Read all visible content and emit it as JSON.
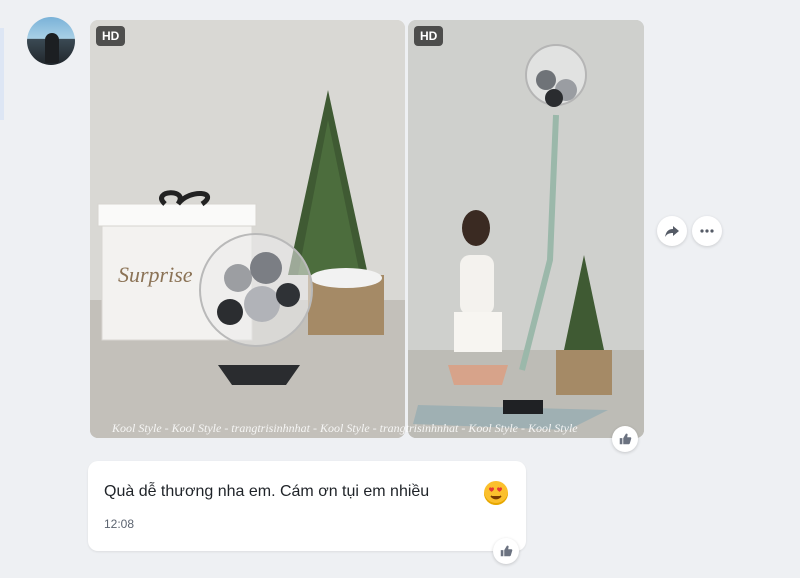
{
  "photos": [
    {
      "badge": "HD"
    },
    {
      "badge": "HD"
    }
  ],
  "photo_caption_text": "Surprise",
  "watermark": "Kool Style - Kool Style - trangtrisinhnhat - Kool Style - trangtrisinhnhat - Kool Style - Kool Style",
  "message": {
    "text": "Quà dễ thương nha em. Cám ơn tụi em nhiều",
    "time": "12:08",
    "emoji": "heart-eyes-emoji"
  },
  "actions": {
    "share_icon": "share-icon",
    "more_icon": "more-icon",
    "like_icon": "thumbs-up-icon"
  },
  "colors": {
    "background": "#eef0f3",
    "bubble": "#ffffff",
    "badge": "#282828",
    "emoji": "#fbc02d"
  }
}
